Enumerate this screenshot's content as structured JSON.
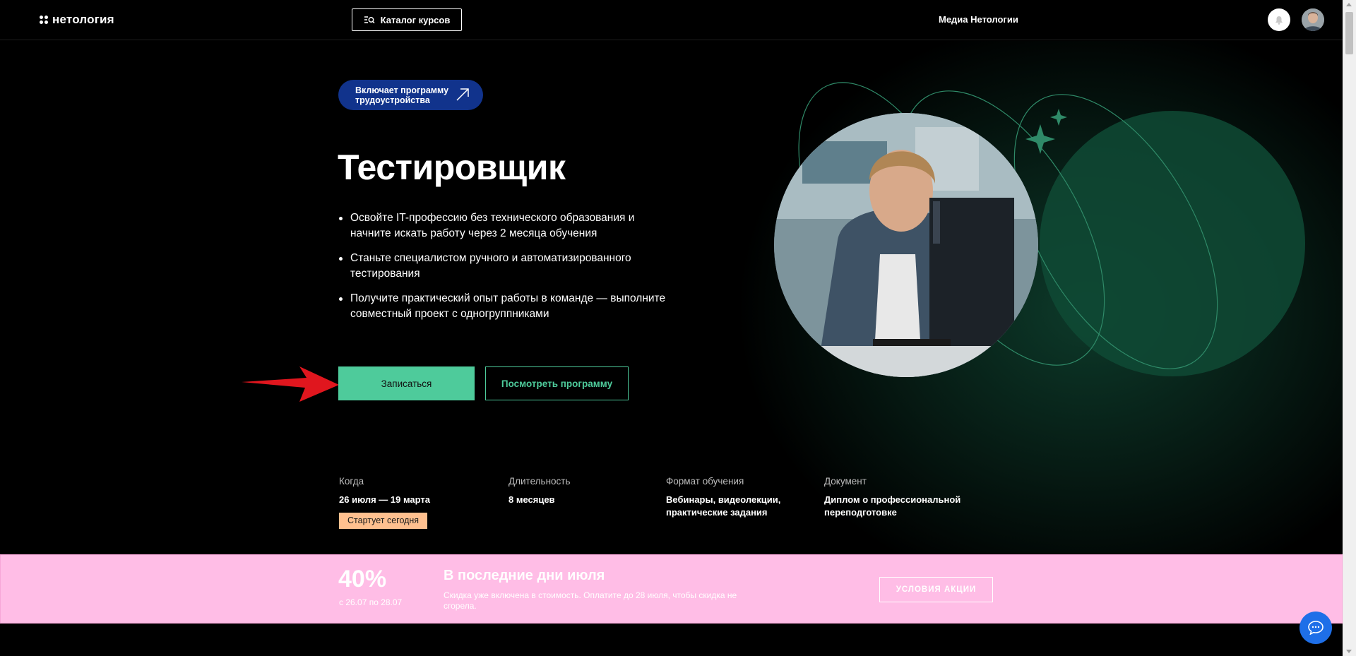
{
  "header": {
    "logo_text": "нетология",
    "catalog_label": "Каталог курсов",
    "media_label": "Медиа Нетологии"
  },
  "hero": {
    "badge_line1": "Включает программу",
    "badge_line2": "трудоустройства",
    "title": "Тестировщик",
    "bullets": [
      "Освойте IT-профессию без технического образования и начните искать работу через 2 месяца обучения",
      "Станьте специалистом ручного и автоматизированного тестирования",
      "Получите практический опыт работы в команде — выполните совместный проект с одногруппниками"
    ],
    "enroll_label": "Записаться",
    "program_label": "Посмотреть программу"
  },
  "info": {
    "when_label": "Когда",
    "when_value": "26 июля — 19 марта",
    "start_badge": "Стартует сегодня",
    "duration_label": "Длительность",
    "duration_value": "8 месяцев",
    "format_label": "Формат обучения",
    "format_value": "Вебинары, видеолекции, практические задания",
    "document_label": "Документ",
    "document_value": "Диплом о профессиональной переподготовке"
  },
  "promo": {
    "percent": "40%",
    "dates": "с 26.07 по 28.07",
    "title": "В последние дни июля",
    "text": "Скидка уже включена в стоимость. Оплатите до 28 июля, чтобы скидка не сгорела.",
    "button_label": "УСЛОВИЯ АКЦИИ"
  },
  "colors": {
    "accent_green": "#4ecb9b",
    "badge_blue": "#11338c",
    "promo_pink": "#ffbde6",
    "start_badge_orange": "#ffc08f",
    "chat_blue": "#1e6fe8",
    "annotation_red": "#e0161e"
  },
  "icons": [
    "logo-icon",
    "catalog-search-icon",
    "bell-icon",
    "avatar",
    "arrow-up-right-icon",
    "sparkle-icon",
    "chat-icon",
    "annotation-arrow"
  ]
}
